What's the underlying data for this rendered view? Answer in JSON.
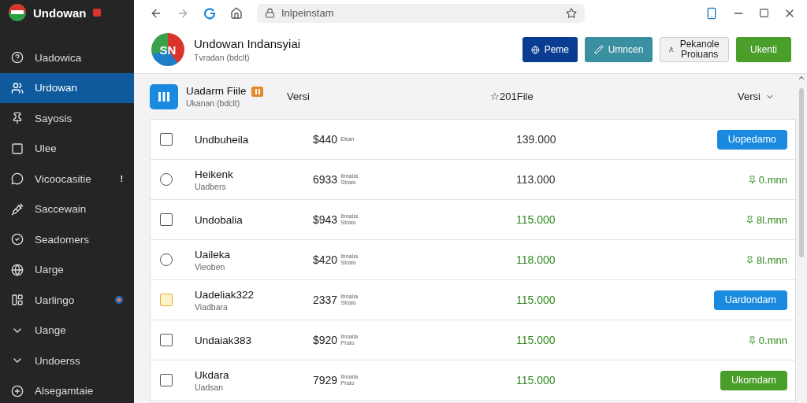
{
  "sidebar": {
    "title": "Undowan",
    "items": [
      {
        "label": "Uadowica",
        "selected": false
      },
      {
        "label": "Urdowan",
        "selected": true
      },
      {
        "label": "Sayosis",
        "selected": false
      },
      {
        "label": "Ulee",
        "selected": false
      },
      {
        "label": "Vicoocasitie",
        "selected": false,
        "badge": "!"
      },
      {
        "label": "Saccewain",
        "selected": false
      },
      {
        "label": "Seadomers",
        "selected": false
      },
      {
        "label": "Uarge",
        "selected": false
      },
      {
        "label": "Uarlingo",
        "selected": false,
        "dot": true
      },
      {
        "label": "Uange",
        "selected": false
      },
      {
        "label": "Undoerss",
        "selected": false
      },
      {
        "label": "Alsegamtaie",
        "selected": false
      }
    ]
  },
  "browser": {
    "address": "Inlpeinstam"
  },
  "header": {
    "logo": "SN",
    "title": "Undowan Indansyiai",
    "subtitle": "Tvradan (bdclt)",
    "buttons": [
      {
        "label": "Peme",
        "kind": "navy"
      },
      {
        "label": "Umncen",
        "kind": "teal"
      },
      {
        "label": "Pekanole Proiuans",
        "kind": "light"
      },
      {
        "label": "Ukenti",
        "kind": "green"
      }
    ]
  },
  "table": {
    "title": "Uadarm Fiile",
    "subtitle": "Ukanan (bdclt)",
    "columns": [
      "Versi",
      "☆201File",
      "Versi"
    ],
    "rows": [
      {
        "kind": "square",
        "name": "Undbuheila",
        "price": "$440",
        "note": [
          "Ekan"
        ],
        "value": "139.000",
        "highlight": false,
        "action": {
          "kind": "button",
          "label": "Uopedamo",
          "color": "#1a8ae0"
        }
      },
      {
        "kind": "circle",
        "name": "Heikenk",
        "sub": "Uadbers",
        "price": "6933",
        "note": [
          "Ibnaiia",
          "Stralo"
        ],
        "value": "113.000",
        "highlight": false,
        "action": {
          "kind": "status",
          "label": "0.mnn"
        }
      },
      {
        "kind": "square",
        "name": "Undobalia",
        "price": "$943",
        "note": [
          "Ibnaiia",
          "Stralo"
        ],
        "value": "115.000",
        "highlight": true,
        "action": {
          "kind": "status",
          "label": "8l.mnn"
        }
      },
      {
        "kind": "circle",
        "name": "Uaileka",
        "sub": "Vieoben",
        "price": "$420",
        "note": [
          "Ibnaiia",
          "Stralo"
        ],
        "value": "118.000",
        "highlight": true,
        "action": {
          "kind": "status",
          "label": "8l.mnn"
        }
      },
      {
        "kind": "warn",
        "name": "Uadeliak322",
        "sub": "Viadbara",
        "price": "2337",
        "note": [
          "Ibnaiia",
          "Stralo"
        ],
        "value": "115.000",
        "highlight": true,
        "action": {
          "kind": "button",
          "label": "Uardondam",
          "color": "#1a8ae0"
        }
      },
      {
        "kind": "square",
        "name": "Undaiak383",
        "price": "$920",
        "note": [
          "Ibnaiia",
          "Praio"
        ],
        "value": "115.000",
        "highlight": true,
        "action": {
          "kind": "status",
          "label": "0.mnn"
        }
      },
      {
        "kind": "square",
        "name": "Ukdara",
        "sub": "Uadsan",
        "price": "7929",
        "note": [
          "Ibnaiia",
          "Praio"
        ],
        "value": "115.000",
        "highlight": true,
        "action": {
          "kind": "button",
          "label": "Ukomdam",
          "color": "#4a9e2a"
        }
      }
    ]
  }
}
